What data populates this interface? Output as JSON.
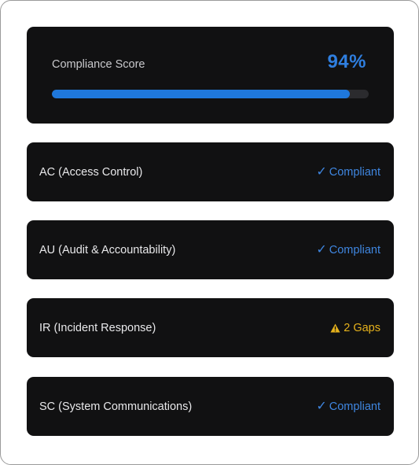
{
  "score": {
    "label": "Compliance Score",
    "value_text": "94%",
    "percent": 94,
    "accent_color": "#2f7fe0"
  },
  "controls": [
    {
      "name": "AC (Access Control)",
      "status_icon": "checkmark-icon",
      "status_glyph": "✓",
      "status_text": "Compliant",
      "status": "ok",
      "color": "#3f86e0"
    },
    {
      "name": "AU (Audit & Accountability)",
      "status_icon": "checkmark-icon",
      "status_glyph": "✓",
      "status_text": "Compliant",
      "status": "ok",
      "color": "#3f86e0"
    },
    {
      "name": "IR (Incident Response)",
      "status_icon": "warning-icon",
      "status_glyph": "",
      "status_text": "2 Gaps",
      "status": "warn",
      "color": "#e6b21c"
    },
    {
      "name": "SC (System Communications)",
      "status_icon": "checkmark-icon",
      "status_glyph": "✓",
      "status_text": "Compliant",
      "status": "ok",
      "color": "#3f86e0"
    }
  ]
}
